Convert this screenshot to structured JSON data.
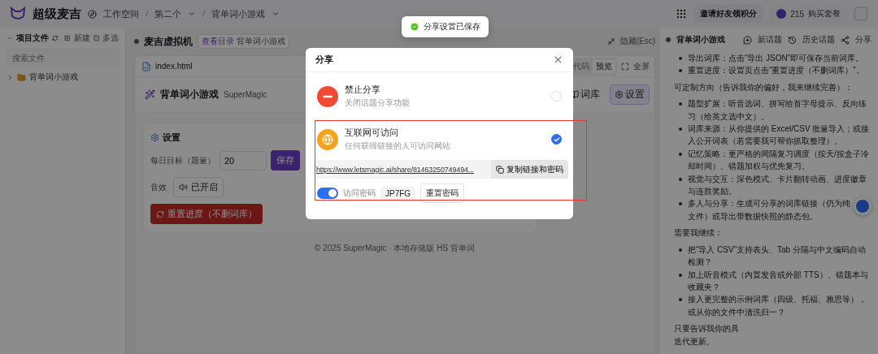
{
  "topbar": {
    "logo": "超级麦吉",
    "workspace": "工作空间",
    "breadcrumbs": [
      {
        "separator": "/",
        "label": "第二个"
      },
      {
        "separator": "/",
        "label": "背单词小游戏"
      }
    ],
    "invite": "邀请好友领积分",
    "credits": "215",
    "buy": "购买套餐"
  },
  "sidebar": {
    "title": "项目文件",
    "new": "新建",
    "multi": "多选",
    "search_placeholder": "搜索文件",
    "tree": [
      {
        "label": "背单词小游戏",
        "expanded": false
      }
    ]
  },
  "workspace": {
    "title": "麦吉虚拟机",
    "tag": "查看目录",
    "tag_path": "背单词小游戏",
    "hide": "隐藏(Esc)",
    "file_tab": "index.html",
    "view_tabs": [
      {
        "label": "代码",
        "selected": false
      },
      {
        "label": "预览",
        "selected": true
      }
    ],
    "fullscreen": "全屏",
    "app": {
      "title": "背单词小游戏",
      "brand": "SuperMagic",
      "buttons": [
        {
          "label": "词库",
          "selected": false
        },
        {
          "label": "设置",
          "selected": true
        }
      ],
      "settings": {
        "title": "设置",
        "goal_label": "每日目标（题量）",
        "goal_value": "20",
        "save": "保存",
        "sound_label": "音效",
        "sound_value": "已开启",
        "reset": "重置进度（不删词库）"
      },
      "footer": "© 2025 SuperMagic · 本地存储版 HS 背单词"
    }
  },
  "chat": {
    "title": "背单词小游戏",
    "actions": [
      {
        "kind": "new",
        "label": "新话题"
      },
      {
        "kind": "history",
        "label": "历史话题"
      },
      {
        "kind": "share",
        "label": "分享"
      }
    ],
    "blocks": [
      {
        "kind": "list",
        "items": [
          {
            "lines": [
              "导出词库：点击“导出 JSON”即可保存当前词库。"
            ]
          },
          {
            "lines": [
              "重置进度：设置页点击“重置进度（不删词库）”。"
            ]
          }
        ]
      },
      {
        "kind": "para",
        "lines": [
          "可定制方向（告诉我你的偏好，我来继续完善）："
        ]
      },
      {
        "kind": "list",
        "items": [
          {
            "lines": [
              "题型扩展：听音选词、拼写给首字母提示、反向练习（给英文选中文）。"
            ]
          },
          {
            "lines": [
              "词库来源：从你提供的 Excel/CSV 批量导入；或接入公开词表（若需要我可帮你抓取整理）。"
            ]
          },
          {
            "lines": [
              "记忆策略：更严格的间隔复习调度（按天/按盒子冷却时间）、错题加权与优先复习。"
            ]
          },
          {
            "lines": [
              "视觉与交互：深色模式、卡片翻转动画、进度徽章与连胜奖励。"
            ]
          },
          {
            "lines": [
              "多人与分享：生成可分享的词库链接（仍为纯",
              "文件）或导出带数据快照的静态包。"
            ]
          }
        ]
      },
      {
        "kind": "para",
        "lines": [
          "需要我继续："
        ]
      },
      {
        "kind": "list",
        "items": [
          {
            "lines": [
              "把“导入 CSV”支持表头、Tab 分隔与中文编码自动检测？"
            ]
          },
          {
            "lines": [
              "加上听音模式（内置发音或外部 TTS）、错题本与收藏夹？"
            ]
          },
          {
            "lines": [
              "接入更完整的示例词库（四级、托福、雅思等），或从你的文件中清洗归一？"
            ]
          }
        ]
      },
      {
        "kind": "para",
        "lines": [
          "只要告诉我你的具",
          "迭代更新。"
        ]
      }
    ]
  },
  "toast": {
    "text": "分享设置已保存"
  },
  "share_dialog": {
    "title": "分享",
    "options": [
      {
        "kind": "disable",
        "title": "禁止分享",
        "description": "关闭话题分享功能",
        "selected": false
      },
      {
        "kind": "public",
        "title": "互联网可访问",
        "description": "任何获得链接的人可访问网站",
        "selected": true
      }
    ],
    "link": "https://www.letsmagic.ai/share/81463250749494...",
    "copy": "复制链接和密码",
    "password_enabled": true,
    "password_label": "访问密码",
    "password": "JP7FG",
    "reset_password": "重置密码"
  }
}
